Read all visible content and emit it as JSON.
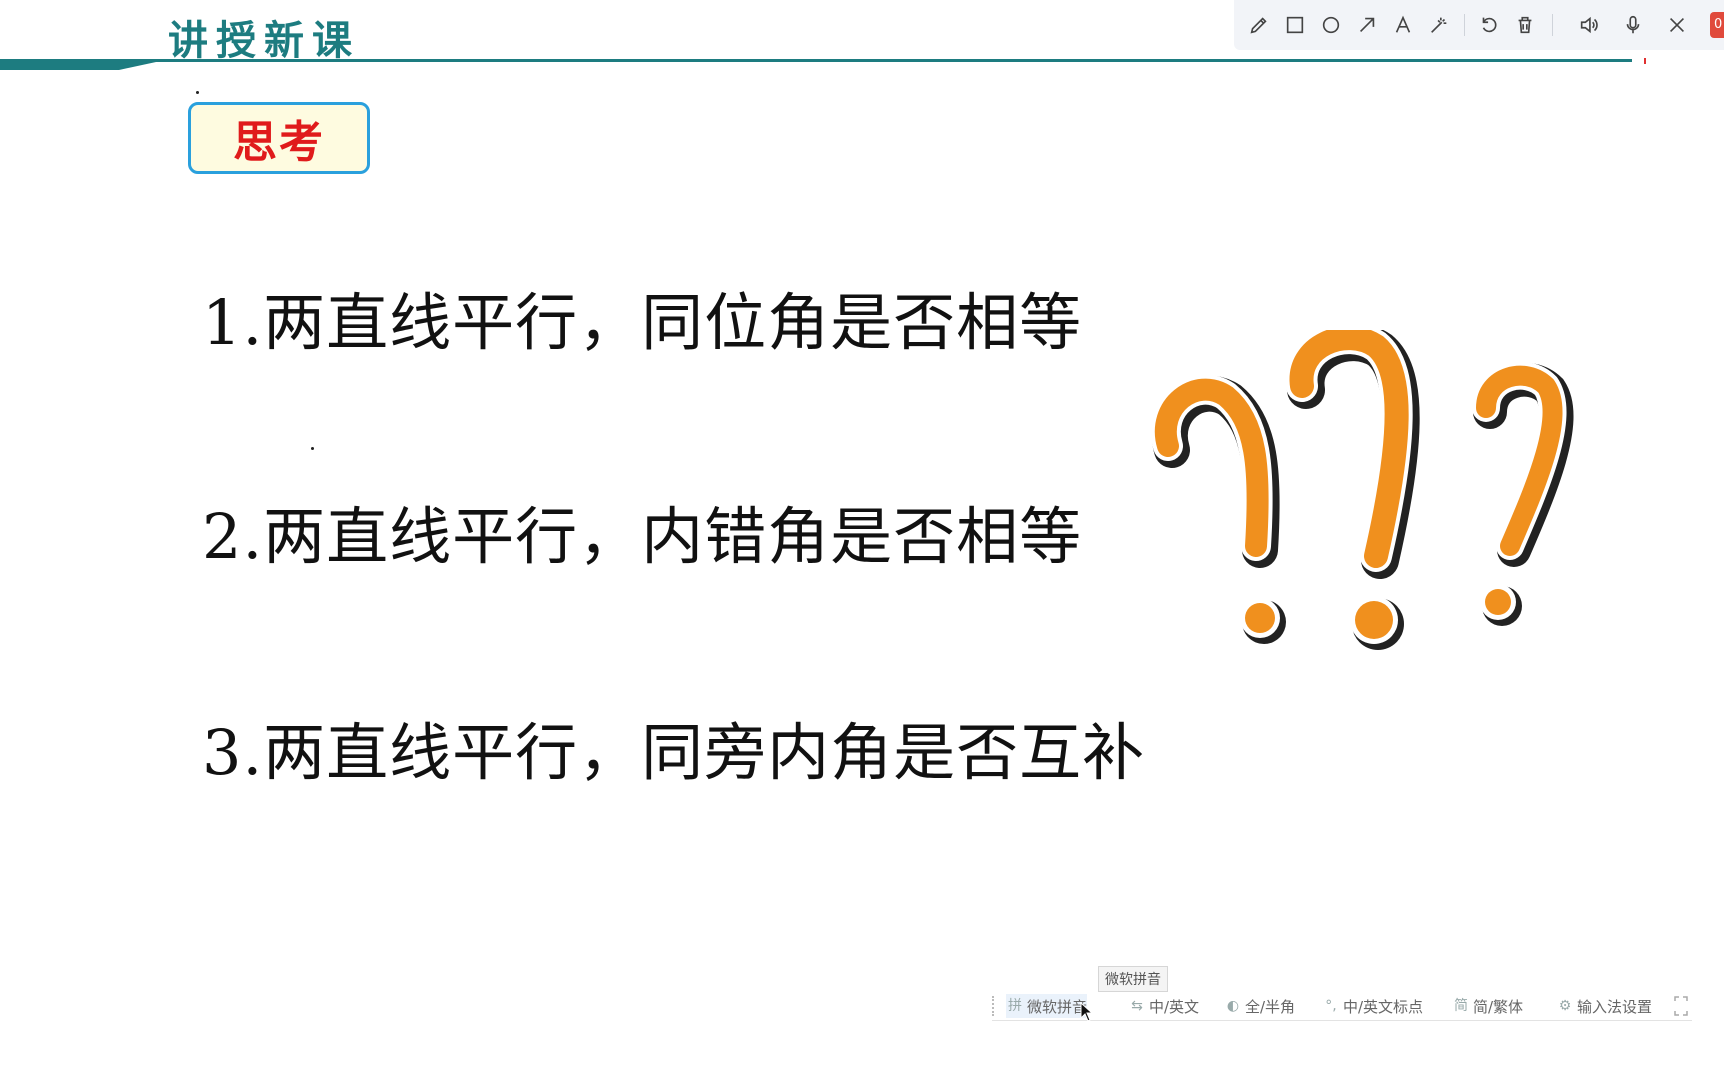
{
  "header": {
    "title": "讲授新课"
  },
  "toolbar": {
    "tools": [
      "pencil-icon",
      "rectangle-icon",
      "circle-icon",
      "arrow-icon",
      "text-icon",
      "magic-wand-icon",
      "undo-icon",
      "trash-icon",
      "speaker-icon",
      "microphone-icon",
      "close-icon"
    ],
    "badge": "0"
  },
  "slide": {
    "think_label": "思考",
    "questions": [
      "1.两直线平行，同位角是否相等",
      "2.两直线平行，内错角是否相等",
      "3.两直线平行，同旁内角是否互补"
    ],
    "accent_color": "#1d7c80",
    "qmark_color": "#f0901e"
  },
  "ime": {
    "tooltip": "微软拼音",
    "items": [
      {
        "icon": "拼",
        "label": "微软拼音"
      },
      {
        "icon": "⇆",
        "label": "中/英文"
      },
      {
        "icon": "◐",
        "label": "全/半角"
      },
      {
        "icon": "°,",
        "label": "中/英文标点"
      },
      {
        "icon": "简",
        "label": "简/繁体"
      },
      {
        "icon": "⚙",
        "label": "输入法设置"
      }
    ]
  }
}
